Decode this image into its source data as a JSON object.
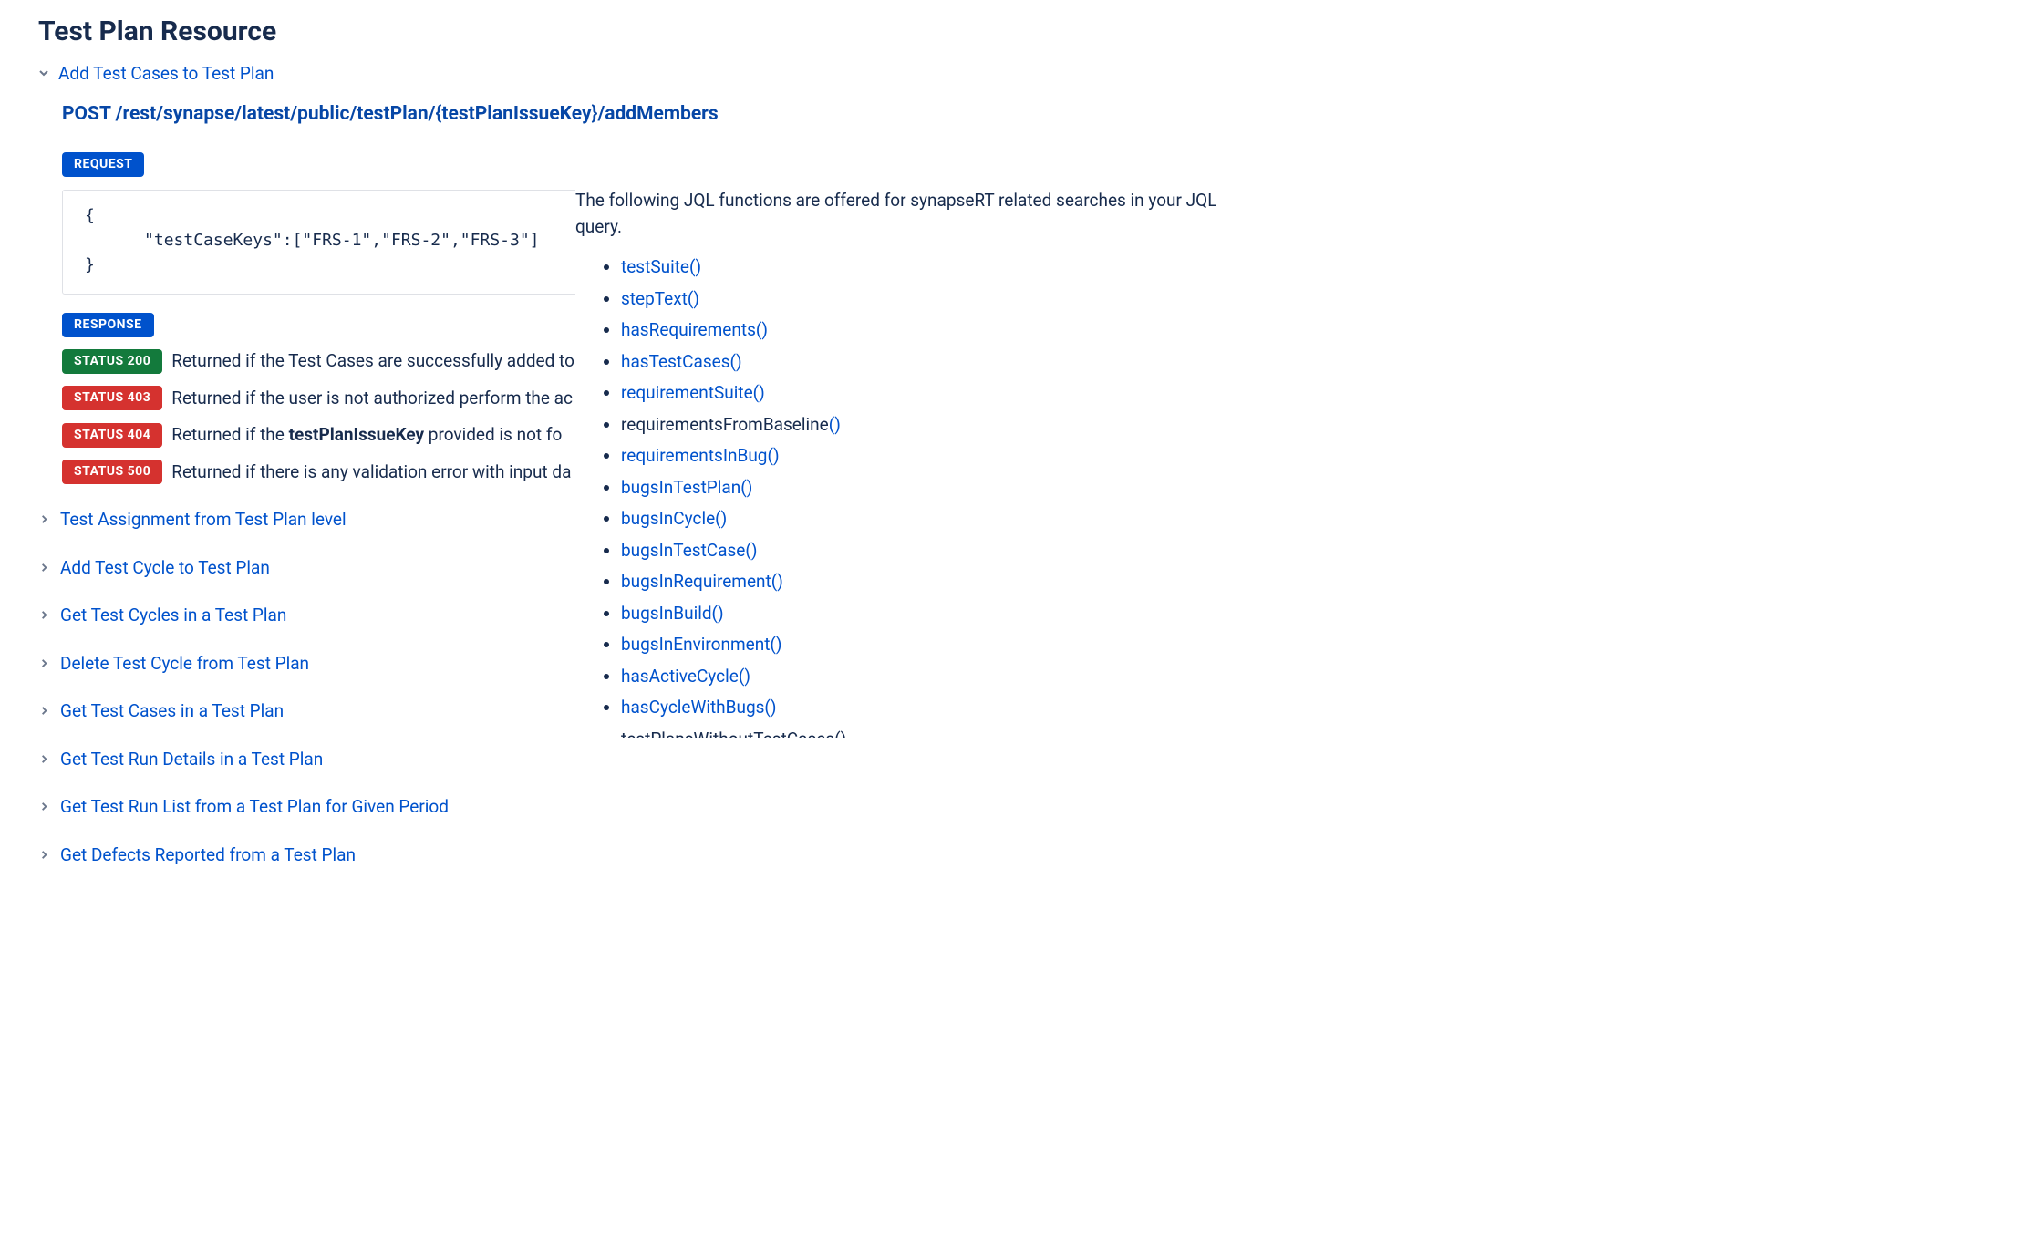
{
  "left": {
    "title": "Test Plan Resource",
    "expanded_label": "Add Test Cases to Test Plan",
    "endpoint_method": "POST",
    "endpoint_path": "/rest/synapse/latest/public/testPlan/{testPlanIssueKey}/addMembers",
    "request_badge": "REQUEST",
    "request_body": "{\n      \"testCaseKeys\":[\"FRS-1\",\"FRS-2\",\"FRS-3\"]\n}",
    "response_badge": "RESPONSE",
    "statuses": [
      {
        "code_label": "STATUS 200",
        "css": "badge-200",
        "prefix": "Returned if the Test Cases are successfully added to",
        "bold": "",
        "suffix": ""
      },
      {
        "code_label": "STATUS 403",
        "css": "badge-403",
        "prefix": "Returned if the user is not authorized perform the ac",
        "bold": "",
        "suffix": ""
      },
      {
        "code_label": "STATUS 404",
        "css": "badge-404",
        "prefix": "Returned if the ",
        "bold": "testPlanIssueKey",
        "suffix": " provided is not fo"
      },
      {
        "code_label": "STATUS 500",
        "css": "badge-500",
        "prefix": "Returned if there is any validation error with input da",
        "bold": "",
        "suffix": ""
      }
    ],
    "collapsed": [
      "Test Assignment from Test Plan level",
      "Add Test Cycle to Test Plan",
      "Get Test Cycles in a Test Plan",
      "Delete Test Cycle from Test Plan",
      "Get Test Cases in a Test Plan",
      "Get Test Run Details in a Test Plan",
      "Get Test Run List from a Test Plan for Given Period",
      "Get Defects Reported from a Test Plan"
    ]
  },
  "right": {
    "intro": "The following JQL functions are offered for synapseRT related searches in your JQL query.",
    "functions": [
      {
        "link_text": "testSuite()",
        "plain_prefix": ""
      },
      {
        "link_text": "stepText()",
        "plain_prefix": ""
      },
      {
        "link_text": "hasRequirements()",
        "plain_prefix": ""
      },
      {
        "link_text": "hasTestCases()",
        "plain_prefix": ""
      },
      {
        "link_text": "requirementSuite()",
        "plain_prefix": ""
      },
      {
        "link_text": "()",
        "plain_prefix": "requirementsFromBaseline"
      },
      {
        "link_text": "requirementsInBug()",
        "plain_prefix": ""
      },
      {
        "link_text": "bugsInTestPlan()",
        "plain_prefix": ""
      },
      {
        "link_text": "bugsInCycle()",
        "plain_prefix": ""
      },
      {
        "link_text": "bugsInTestCase()",
        "plain_prefix": ""
      },
      {
        "link_text": "bugsInRequirement()",
        "plain_prefix": ""
      },
      {
        "link_text": "bugsInBuild()",
        "plain_prefix": ""
      },
      {
        "link_text": "bugsInEnvironment()",
        "plain_prefix": ""
      },
      {
        "link_text": "hasActiveCycle()",
        "plain_prefix": ""
      },
      {
        "link_text": "hasCycleWithBugs()",
        "plain_prefix": ""
      }
    ],
    "cutoff_item": "testPlansWithoutTestCases()"
  }
}
